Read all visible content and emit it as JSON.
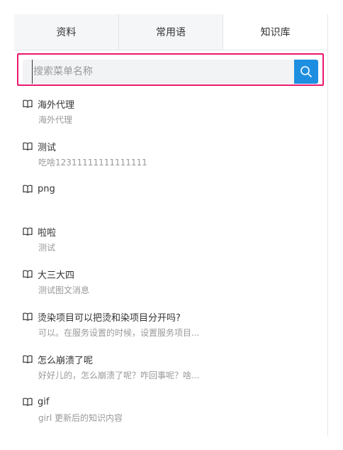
{
  "tabs": [
    {
      "label": "资料"
    },
    {
      "label": "常用语"
    },
    {
      "label": "知识库"
    }
  ],
  "search": {
    "placeholder": "搜索菜单名称",
    "value": ""
  },
  "items": [
    {
      "title": "海外代理",
      "desc": "海外代理"
    },
    {
      "title": "测试",
      "desc": "吃啥12311111111111111"
    },
    {
      "title": "png",
      "desc": ""
    },
    {
      "title": "啦啦",
      "desc": "测试"
    },
    {
      "title": "大三大四",
      "desc": "测试图文消息"
    },
    {
      "title": "烫染项目可以把烫和染项目分开吗?",
      "desc": "可以。在服务设置的时候，设置服务项目..."
    },
    {
      "title": "怎么崩溃了呢",
      "desc": "好好儿的，怎么崩溃了呢？咋回事呢？啥..."
    },
    {
      "title": "gif",
      "desc": "girl 更新后的知识内容"
    }
  ],
  "icons": {
    "item_icon": "book-open-icon",
    "search_icon": "search-icon"
  },
  "colors": {
    "accent": "#1e8fe0",
    "highlight_outline": "#e8196e"
  }
}
